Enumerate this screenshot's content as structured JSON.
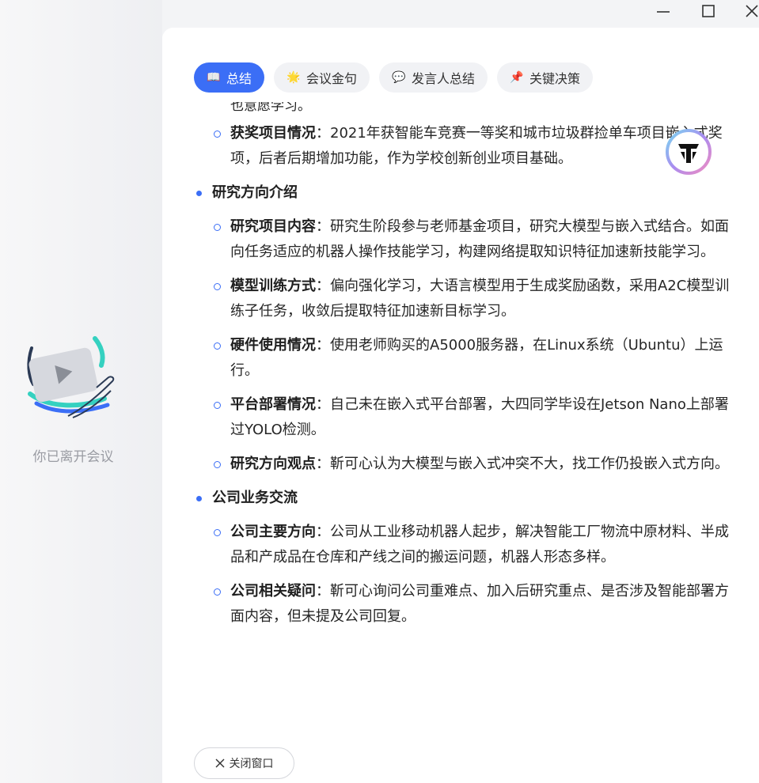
{
  "left_pane": {
    "status_text": "你已离开会议"
  },
  "tabs": [
    {
      "label": "总结",
      "icon": "book-icon",
      "active": true
    },
    {
      "label": "会议金句",
      "icon": "sparkle-icon",
      "active": false
    },
    {
      "label": "发言人总结",
      "icon": "chat-bubble-icon",
      "active": false
    },
    {
      "label": "关键决策",
      "icon": "pin-icon",
      "active": false
    }
  ],
  "summary": {
    "clipped_top_text": "也意愿学习。",
    "award": {
      "label": "获奖项目情况",
      "text": "：2021年获智能车竞赛一等奖和城市垃圾群捡单车项目嵌入式奖项，后者后期增加功能，作为学校创新创业项目基础。"
    },
    "research": {
      "title": "研究方向介绍",
      "items": [
        {
          "label": "研究项目内容",
          "text": "：研究生阶段参与老师基金项目，研究大模型与嵌入式结合。如面向任务适应的机器人操作技能学习，构建网络提取知识特征加速新技能学习。"
        },
        {
          "label": "模型训练方式",
          "text": "：偏向强化学习，大语言模型用于生成奖励函数，采用A2C模型训练子任务，收敛后提取特征加速新目标学习。"
        },
        {
          "label": "硬件使用情况",
          "text": "：使用老师购买的A5000服务器，在Linux系统（Ubuntu）上运行。"
        },
        {
          "label": "平台部署情况",
          "text": "：自己未在嵌入式平台部署，大四同学毕设在Jetson Nano上部署过YOLO检测。"
        },
        {
          "label": "研究方向观点",
          "text": "：靳可心认为大模型与嵌入式冲突不大，找工作仍投嵌入式方向。"
        }
      ]
    },
    "company": {
      "title": "公司业务交流",
      "items": [
        {
          "label": "公司主要方向",
          "text": "：公司从工业移动机器人起步，解决智能工厂物流中原材料、半成品和产成品在仓库和产线之间的搬运问题，机器人形态多样。"
        },
        {
          "label": "公司相关疑问",
          "text": "：靳可心询问公司重难点、加入后研究重点、是否涉及智能部署方面内容，但未提及公司回复。"
        }
      ]
    }
  },
  "footer": {
    "close_label": "关闭窗口"
  },
  "colors": {
    "accent": "#3b6ef6",
    "tab_bg": "#f1f2f5",
    "left_bg": "#f3f4f6"
  }
}
